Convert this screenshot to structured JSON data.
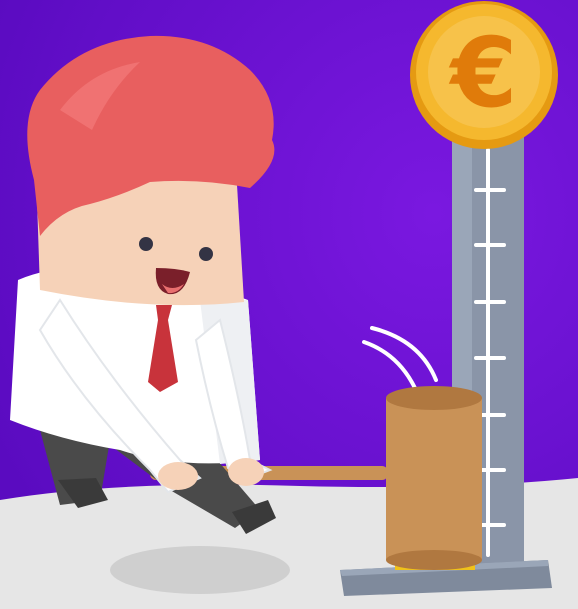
{
  "scene": {
    "coin_symbol": "€",
    "colors": {
      "background_purple": "#6a0fd0",
      "floor": "#e6e6e6",
      "coin_gold": "#f5b82e",
      "coin_rim": "#e59a12",
      "hair": "#e85f5f",
      "skin": "#f6d2b8",
      "shirt": "#ffffff",
      "tie": "#c8333b",
      "pants": "#4a4a4a",
      "mallet": "#c99257",
      "tower": "#8a95a8"
    },
    "icons": [
      "euro-coin-icon",
      "high-striker-tower",
      "mallet",
      "businessman-character"
    ]
  }
}
